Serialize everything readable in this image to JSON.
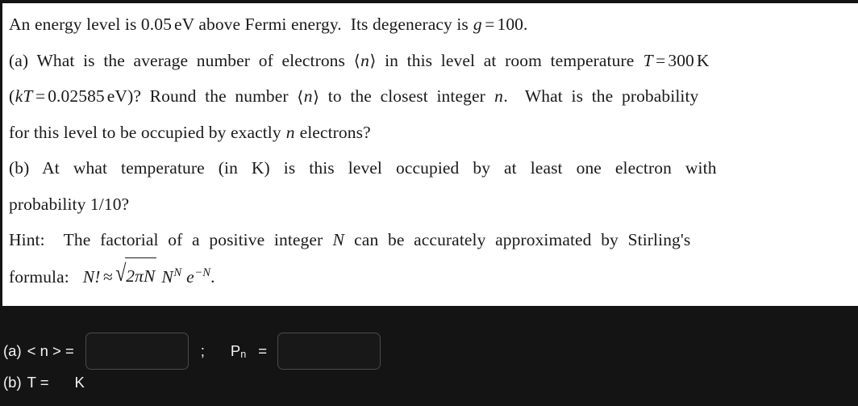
{
  "problem": {
    "lines": [
      {
        "id": "l1",
        "text": "An energy level is 0.05 eV above Fermi energy.  Its degeneracy is g = 100."
      },
      {
        "id": "l2",
        "text": "(a) What is the average number of electrons ⟨n⟩ in this level at room temperature T = 300 K"
      },
      {
        "id": "l3",
        "text": "(kT = 0.02585 eV)? Round the number ⟨n⟩ to the closest integer n.  What is the probability"
      },
      {
        "id": "l4",
        "text": "for this level to be occupied by exactly n electrons?"
      },
      {
        "id": "l5",
        "text": "(b)  At  what  temperature  (in  K)  is  this  level  occupied  by  at  least  one  electron  with"
      },
      {
        "id": "l6",
        "text": "probability 1/10?"
      },
      {
        "id": "l7",
        "text": "Hint:  The  factorial  of  a  positive  integer  N  can  be  accurately  approximated  by  Stirling's"
      },
      {
        "id": "l8",
        "text": "formula:  N! ≈ √(2πN) N^N e^−N."
      }
    ],
    "fragments": {
      "an_energy_level_is": "An energy level is",
      "val_energy": "0.05",
      "unit_ev": "eV",
      "above_fermi": "above Fermi energy.",
      "its_degeneracy_is": "Its degeneracy is",
      "sym_g": "g",
      "eq": "=",
      "val_g": "100.",
      "part_a_label": "(a)",
      "what_is_avg": "What is the average number of electrons",
      "angle_open": "⟨",
      "sym_n_italic": "n",
      "angle_close": "⟩",
      "in_this_level": "in this level at room temperature",
      "sym_T": "T",
      "val_T": "300",
      "unit_K": "K",
      "paren_open": "(",
      "sym_kT": "kT",
      "val_kT": "0.02585",
      "paren_close_q": ")?",
      "round_the_number": "Round the number",
      "to_the_closest_integer": "to the closest integer",
      "dot_after_n": ".",
      "what_is_the_probability": "What is the probability",
      "for_this_level": "for this level to be occupied by exactly",
      "electrons_q": "electrons?",
      "part_b_label": "(b)",
      "b_text": "At  what  temperature  (in  K)  is  this  level  occupied  by  at  least  one  electron  with",
      "probability_frac": "probability 1/10?",
      "hint_label": "Hint:",
      "hint_text_1": "The  factorial  of  a  positive  integer",
      "sym_N": "N",
      "hint_text_2": "can  be  accurately  approximated  by  Stirling's",
      "formula_label": "formula:",
      "n_factorial": "N!",
      "approx": "≈",
      "radical_sign": "√",
      "radicand": "2πN",
      "sym_N2": "N",
      "exp_N": "N",
      "sym_e": "e",
      "exp_minus_N": "−N",
      "period": "."
    }
  },
  "answers": {
    "row_a": {
      "part_label": "(a)",
      "expr_label": "< n > =",
      "input1_value": "",
      "input1_placeholder": "",
      "separator": ";",
      "p_symbol": "P",
      "p_subscript": "n",
      "p_equals": "=",
      "input2_value": "",
      "input2_placeholder": ""
    },
    "row_b": {
      "part_label": "(b)",
      "t_label": "T =",
      "unit": "K"
    }
  },
  "colors": {
    "page_background": "#141414",
    "document_background": "#ffffff",
    "document_text": "#1a1a1a",
    "answer_text": "#f3f3f3",
    "input_background": "#181818",
    "input_border": "#4a4a4a"
  }
}
